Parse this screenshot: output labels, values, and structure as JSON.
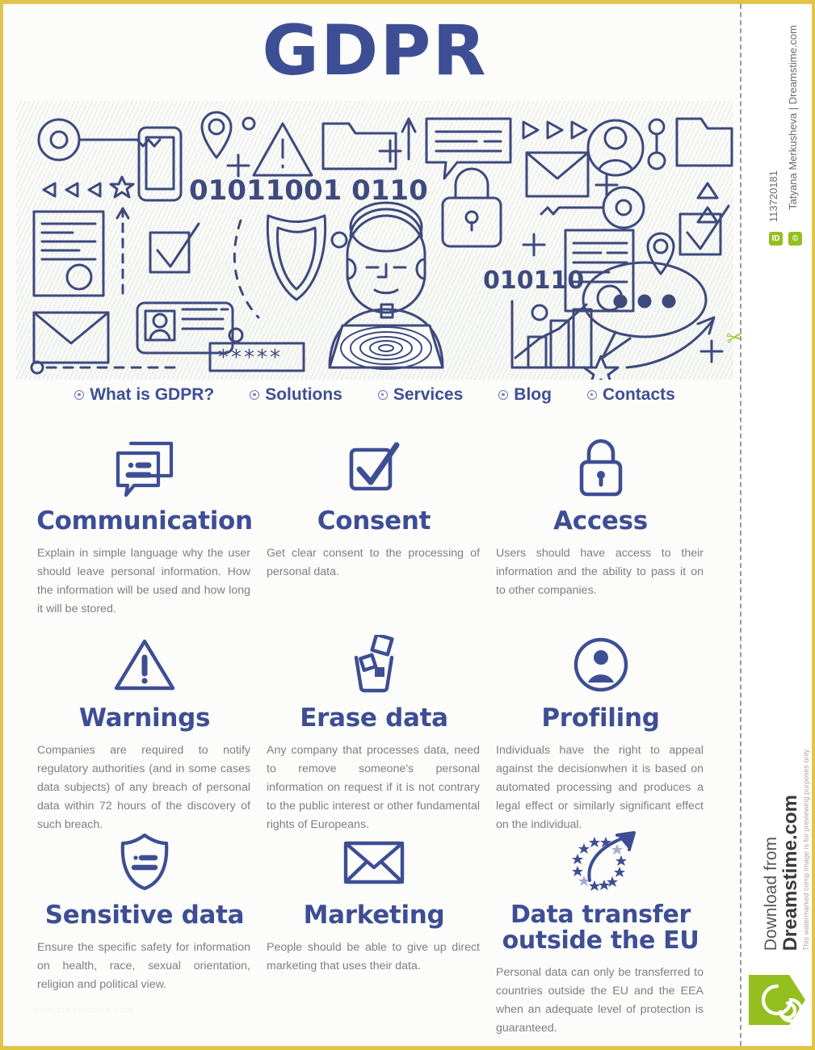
{
  "page": {
    "title": "GDPR",
    "accent_blue": "#3e4e94",
    "body_gray": "#7b7f86",
    "border_yellow": "#e3c44b",
    "brand_green": "#93c01f"
  },
  "nav": {
    "items": [
      {
        "label": "What is GDPR?",
        "icon": "bullet-dot-icon"
      },
      {
        "label": "Solutions",
        "icon": "bullet-dot-icon"
      },
      {
        "label": "Services",
        "icon": "bullet-dot-icon"
      },
      {
        "label": "Blog",
        "icon": "bullet-dot-icon"
      },
      {
        "label": "Contacts",
        "icon": "bullet-dot-icon"
      }
    ]
  },
  "hero": {
    "binary_left": "01011001 0110",
    "binary_right": "010110",
    "password_mask": "*****",
    "icons": [
      "key-icon",
      "smartphone-icon",
      "map-pin-icon",
      "warning-triangle-icon",
      "folder-icon",
      "chat-bubble-icon",
      "envelope-icon",
      "user-circle-icon",
      "document-icon",
      "checkbox-check-icon",
      "shield-icon",
      "padlock-icon",
      "id-card-icon",
      "bar-chart-icon",
      "speech-dots-icon",
      "arrow-up-icon",
      "star-icon",
      "triangle-icon",
      "play-arrow-icon",
      "plus-icon",
      "person-laptop-illustration"
    ]
  },
  "cards": [
    {
      "icon": "chat-bubbles-icon",
      "title": "Communication",
      "body": "Explain in simple language why the user should leave personal information. How the information will be used and how long it will be stored."
    },
    {
      "icon": "checkbox-check-icon",
      "title": "Consent",
      "body": "Get clear consent to the processing of personal data."
    },
    {
      "icon": "padlock-icon",
      "title": "Access",
      "body": "Users should have access to their information and the ability to pass it on to other companies."
    },
    {
      "icon": "warning-triangle-icon",
      "title": "Warnings",
      "body": "Companies are required to notify regulatory authorities (and in some cases data subjects) of any breach of personal data within 72 hours of the discovery of such breach."
    },
    {
      "icon": "trash-bin-icon",
      "title": "Erase data",
      "body": "Any company that processes data, need to remove someone's personal information on request if it is not contrary to the public interest or other fundamental rights of Europeans."
    },
    {
      "icon": "user-circle-icon",
      "title": "Profiling",
      "body": "Individuals have the right to appeal against the decisionwhen it is based on automated processing and produces a legal effect or similarly significant effect on the individual."
    },
    {
      "icon": "shield-data-icon",
      "title": "Sensitive data",
      "body": "Ensure the specific safety for information on health, race, sexual orientation, religion and political view."
    },
    {
      "icon": "envelope-icon",
      "title": "Marketing",
      "body": "People should be able to give up direct marketing that uses their data."
    },
    {
      "icon": "eu-stars-arrow-icon",
      "title": "Data transfer outside the EU",
      "body": "Personal data can only be transferred to countries outside the EU and the EEA when an adequate level of protection is guaranteed."
    }
  ],
  "rail": {
    "author": "Tatyana Merkusheva | Dreamstime.com",
    "image_id": "113720181",
    "badge_id_label": "ID",
    "badge_copyright_label": "©",
    "download_from": "Download from",
    "brand": "Dreamstime.com",
    "disclaimer": "This watermarked comp image is for previewing purposes only.",
    "logo": "dreamstime-spiral-logo",
    "scissors": "✂"
  },
  "corner_watermark": "www.dreamstime.com"
}
